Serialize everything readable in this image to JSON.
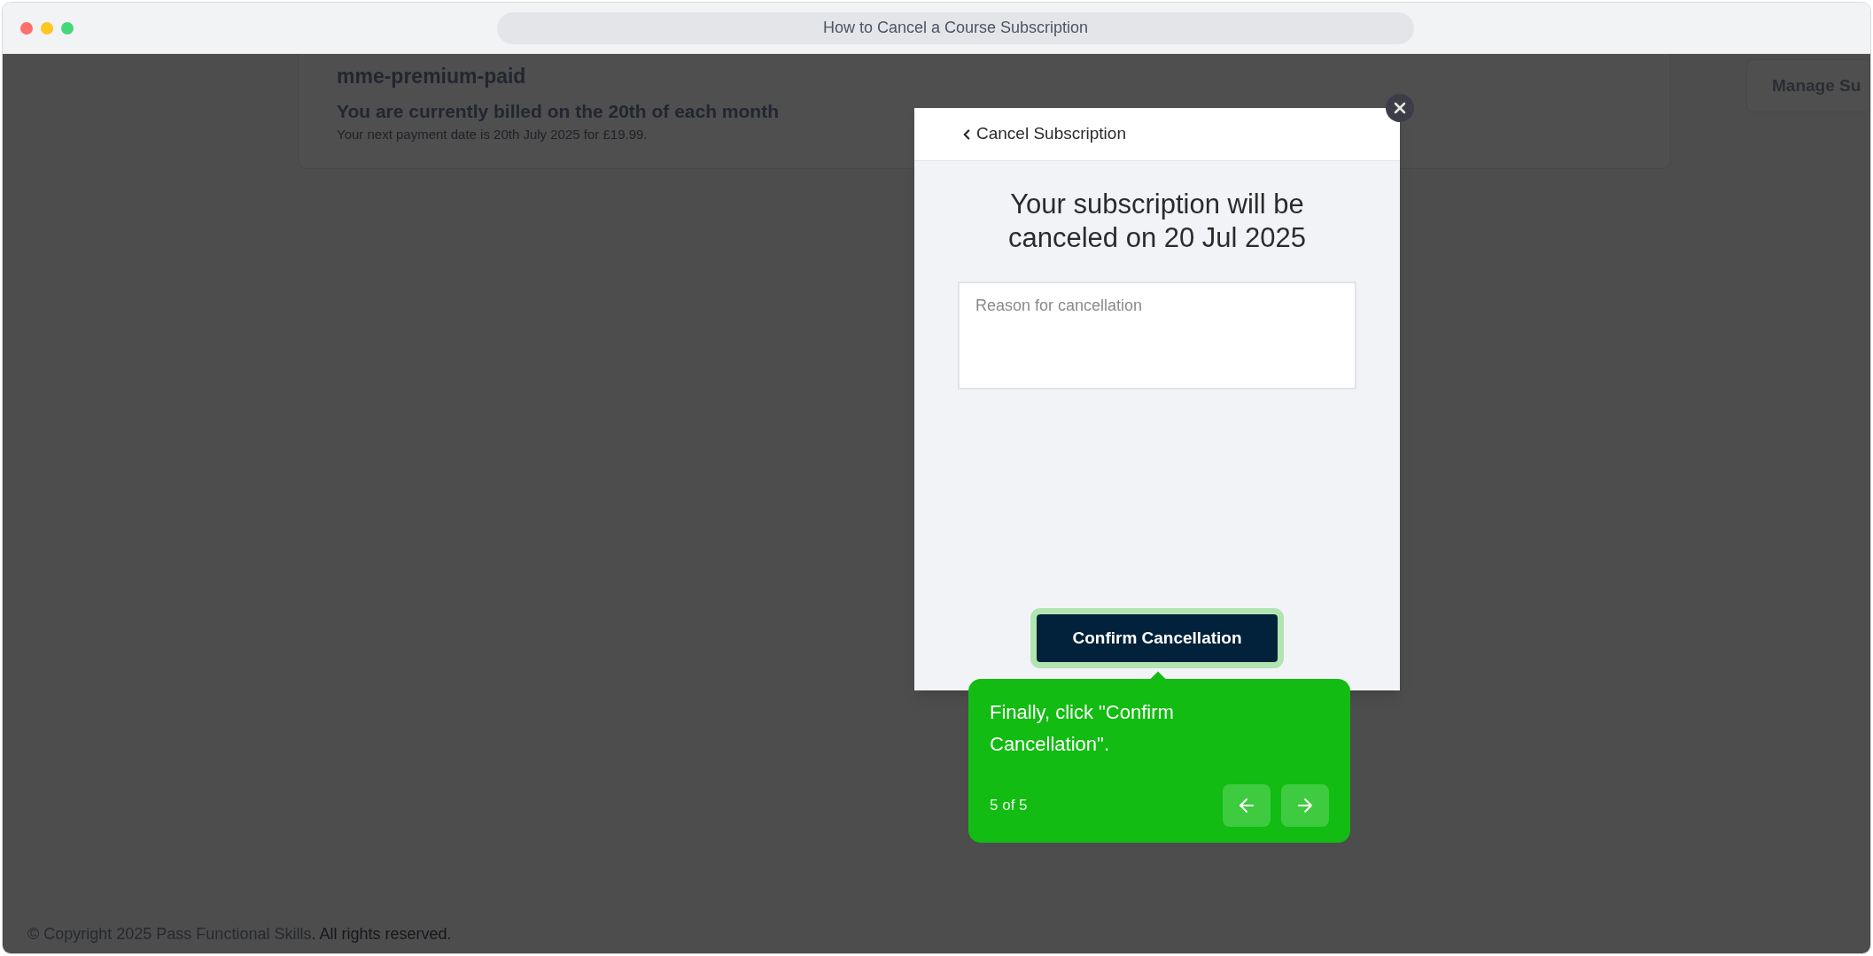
{
  "window": {
    "title": "How to Cancel a Course Subscription"
  },
  "background_page": {
    "plan_name": "mme-premium-paid",
    "billing_heading": "You are currently billed on the 20th of each month",
    "next_payment": "Your next payment date is 20th July 2025 for £19.99.",
    "manage_button": "Manage Su",
    "footer": {
      "copyright_link": "© Copyright 2025 Pass Functional Skills",
      "rest": ". All rights reserved."
    }
  },
  "modal": {
    "back_label": "Cancel Subscription",
    "heading": "Your subscription will be canceled on 20 Jul 2025",
    "reason_field": {
      "placeholder": "Reason for cancellation"
    },
    "confirm_button": {
      "label": "Confirm Cancellation",
      "highlighted": true
    }
  },
  "tour_tip": {
    "text": "Finally, click \"Confirm Cancellation\".",
    "step": "5 of 5",
    "buttons": [
      {
        "kind": "back"
      },
      {
        "kind": "next"
      }
    ]
  }
}
